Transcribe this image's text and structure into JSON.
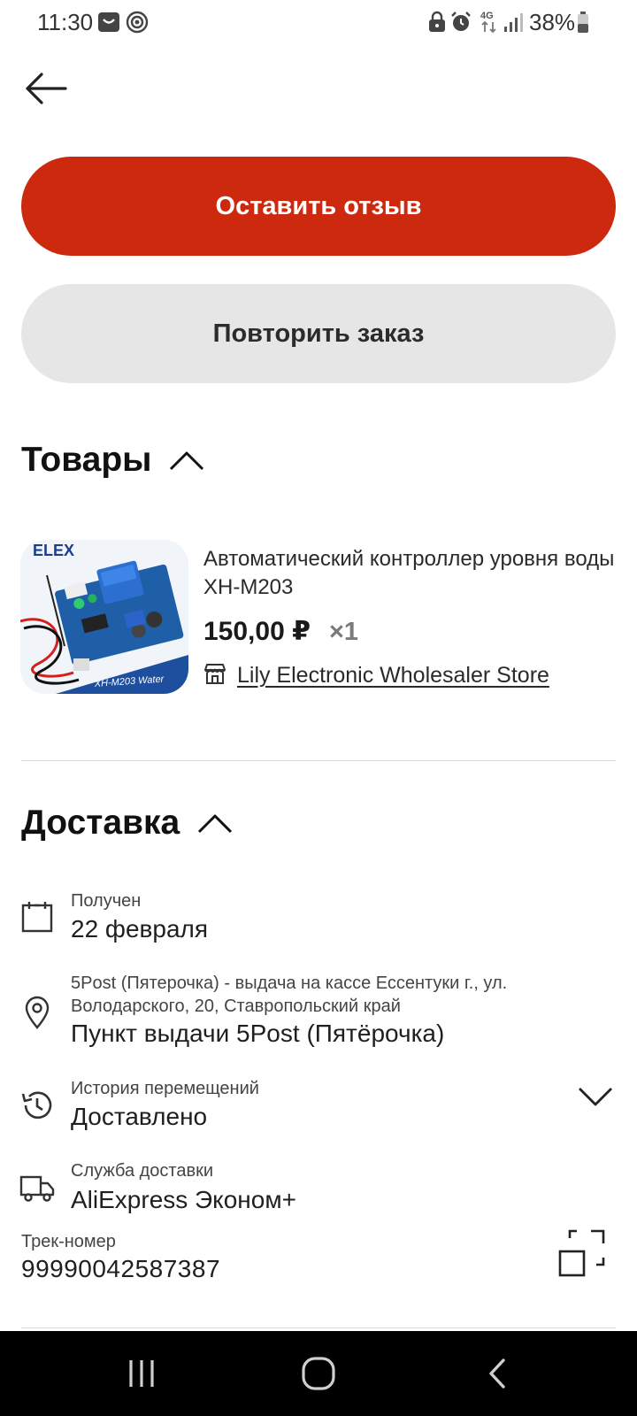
{
  "status_bar": {
    "time": "11:30",
    "battery": "38%",
    "network": "4G",
    "icons": [
      "message-icon",
      "target-icon",
      "lock-icon",
      "alarm-icon",
      "4g-icon",
      "signal-icon",
      "battery-icon"
    ]
  },
  "header": {
    "back_icon": "arrow-left-icon"
  },
  "actions": {
    "review_label": "Оставить отзыв",
    "repeat_label": "Повторить заказ"
  },
  "goods": {
    "title": "Товары",
    "product": {
      "name": "Автоматический контроллер уровня воды XH-M203",
      "price": "150,00 ₽",
      "quantity": "×1",
      "store": "Lily Electronic Wholesaler Store",
      "image_brand": "ELEX",
      "image_caption": "XH-M203 Water"
    }
  },
  "delivery": {
    "title": "Доставка",
    "received": {
      "label": "Получен",
      "value": "22 февраля"
    },
    "pickup": {
      "address_line1": "5Post (Пятерочка) - выдача на кассе Ессентуки г., ул.",
      "address_line2": "Володарского, 20, Ставропольский край",
      "value": "Пункт выдачи 5Post (Пятёрочка)"
    },
    "history": {
      "label": "История перемещений",
      "value": "Доставлено"
    },
    "service": {
      "label": "Служба доставки",
      "value": "AliExpress Эконом+"
    },
    "tracking": {
      "label": "Трек-номер",
      "value": "99990042587387"
    }
  },
  "colors": {
    "accent": "#cc290e",
    "secondary_button": "#e6e6e6",
    "nav_bar": "#000000"
  }
}
